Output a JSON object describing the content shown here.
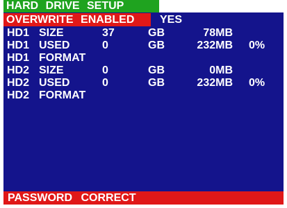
{
  "title": "HARD  DRIVE  SETUP",
  "overwrite": {
    "label": "OVERWRITE  ENABLED",
    "value": "YES"
  },
  "rows": [
    {
      "drive": "HD1",
      "label": "SIZE",
      "number": "37",
      "unit": "GB",
      "mb": "78MB",
      "percent": ""
    },
    {
      "drive": "HD1",
      "label": "USED",
      "number": "0",
      "unit": "GB",
      "mb": "232MB",
      "percent": "0%"
    },
    {
      "drive": "HD1",
      "label": "FORMAT",
      "number": "",
      "unit": "",
      "mb": "",
      "percent": ""
    },
    {
      "drive": "HD2",
      "label": "SIZE",
      "number": "0",
      "unit": "GB",
      "mb": "0MB",
      "percent": ""
    },
    {
      "drive": "HD2",
      "label": "USED",
      "number": "0",
      "unit": "GB",
      "mb": "232MB",
      "percent": "0%"
    },
    {
      "drive": "HD2",
      "label": "FORMAT",
      "number": "",
      "unit": "",
      "mb": "",
      "percent": ""
    }
  ],
  "status": "PASSWORD  CORRECT",
  "colors": {
    "panel": "#14148c",
    "title": "#1fa31f",
    "highlight": "#e01818",
    "text": "#ffffff"
  }
}
